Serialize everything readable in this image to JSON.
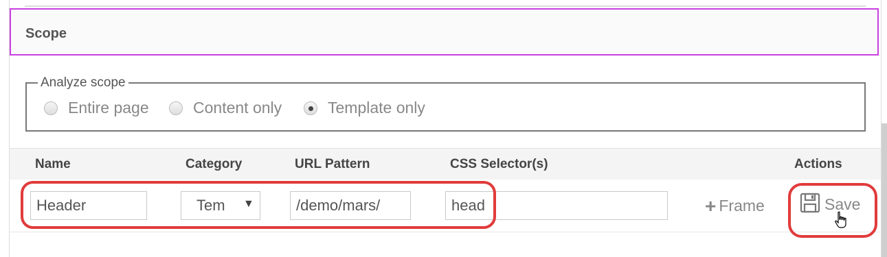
{
  "scope": {
    "title": "Scope"
  },
  "analyze_scope": {
    "legend": "Analyze scope",
    "options": [
      {
        "label": "Entire page",
        "checked": false
      },
      {
        "label": "Content only",
        "checked": false
      },
      {
        "label": "Template only",
        "checked": true
      }
    ]
  },
  "table": {
    "headers": {
      "name": "Name",
      "category": "Category",
      "url_pattern": "URL Pattern",
      "css_selector": "CSS Selector(s)",
      "actions": "Actions"
    },
    "row": {
      "name": "Header",
      "category": "Tem",
      "url_pattern": "/demo/mars/",
      "css_selector_1": "head",
      "css_selector_2": ""
    },
    "actions": {
      "frame_label": "Frame",
      "save_label": "Save"
    }
  },
  "icons": {
    "frame": "plus-icon",
    "save": "floppy-disk-icon",
    "cursor": "hand-pointer-icon",
    "select": "triangle-down-icon"
  },
  "colors": {
    "highlight_purple": "#c93fe0",
    "annotation_red": "#e13b3b"
  }
}
